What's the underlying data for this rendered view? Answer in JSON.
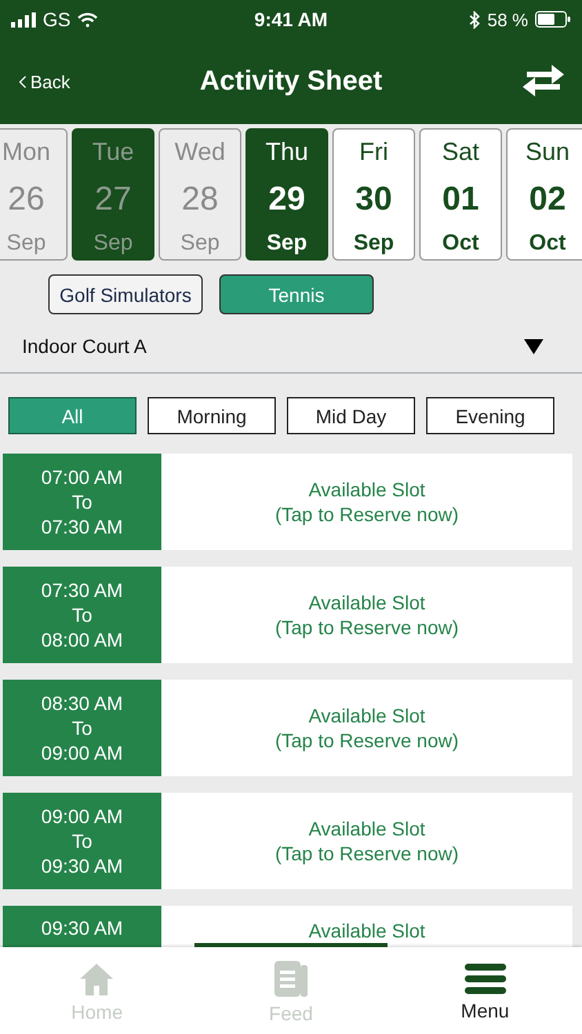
{
  "status_bar": {
    "carrier": "GS",
    "time": "9:41 AM",
    "battery": "58 %"
  },
  "header": {
    "back": "Back",
    "title": "Activity Sheet"
  },
  "days": [
    {
      "weekday": "Mon",
      "day": "26",
      "month": "Sep",
      "disabled": true,
      "today": false,
      "selected": false
    },
    {
      "weekday": "Tue",
      "day": "27",
      "month": "Sep",
      "disabled": true,
      "today": true,
      "selected": false
    },
    {
      "weekday": "Wed",
      "day": "28",
      "month": "Sep",
      "disabled": true,
      "today": false,
      "selected": false
    },
    {
      "weekday": "Thu",
      "day": "29",
      "month": "Sep",
      "disabled": false,
      "today": false,
      "selected": true
    },
    {
      "weekday": "Fri",
      "day": "30",
      "month": "Sep",
      "disabled": false,
      "today": false,
      "selected": false
    },
    {
      "weekday": "Sat",
      "day": "01",
      "month": "Oct",
      "disabled": false,
      "today": false,
      "selected": false
    },
    {
      "weekday": "Sun",
      "day": "02",
      "month": "Oct",
      "disabled": false,
      "today": false,
      "selected": false
    }
  ],
  "categories": [
    {
      "label": "Golf Simulators",
      "selected": false
    },
    {
      "label": "Tennis",
      "selected": true
    }
  ],
  "court": {
    "value": "Indoor Court A"
  },
  "filters": [
    {
      "label": "All",
      "selected": true
    },
    {
      "label": "Morning",
      "selected": false
    },
    {
      "label": "Mid Day",
      "selected": false
    },
    {
      "label": "Evening",
      "selected": false
    }
  ],
  "slots": [
    {
      "start": "07:00 AM",
      "to": "To",
      "end": "07:30 AM",
      "status": "Available Slot",
      "hint": "(Tap to Reserve now)"
    },
    {
      "start": "07:30 AM",
      "to": "To",
      "end": "08:00 AM",
      "status": "Available Slot",
      "hint": "(Tap to Reserve now)"
    },
    {
      "start": "08:30 AM",
      "to": "To",
      "end": "09:00 AM",
      "status": "Available Slot",
      "hint": "(Tap to Reserve now)"
    },
    {
      "start": "09:00 AM",
      "to": "To",
      "end": "09:30 AM",
      "status": "Available Slot",
      "hint": "(Tap to Reserve now)"
    },
    {
      "start": "09:30 AM",
      "status": "Available Slot"
    }
  ],
  "tab_bar": [
    {
      "label": "Home",
      "kind": "home",
      "selected": false
    },
    {
      "label": "Feed",
      "kind": "feed",
      "selected": false
    },
    {
      "label": "Menu",
      "kind": "menu",
      "selected": true
    }
  ]
}
